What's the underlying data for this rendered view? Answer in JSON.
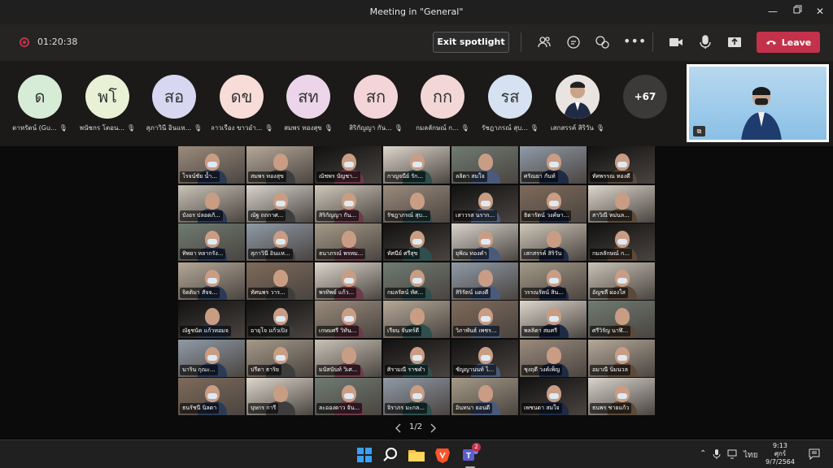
{
  "window": {
    "title": "Meeting in \"General\""
  },
  "toolbar": {
    "timer": "01:20:38",
    "exit_spotlight_label": "Exit spotlight",
    "leave_label": "Leave"
  },
  "participants_strip": {
    "items": [
      {
        "initials": "ด",
        "name": "ดาหรัตน์ (Gu...",
        "color": "#d6ecd6"
      },
      {
        "initials": "พโ",
        "name": "พนัชกร โตอน...",
        "color": "#e8f0d6"
      },
      {
        "initials": "สอ",
        "name": "สุภาวินี อินแห...",
        "color": "#d8d7f2"
      },
      {
        "initials": "ดข",
        "name": "ดาวเรือง ขาวอำ...",
        "color": "#f7dcd7"
      },
      {
        "initials": "สท",
        "name": "สมพร ทองสุข",
        "color": "#ecd5ea"
      },
      {
        "initials": "สก",
        "name": "สิริกัญญา กัน...",
        "color": "#f3d5d9"
      },
      {
        "initials": "กก",
        "name": "กมลลักษณ์ ก...",
        "color": "#f3d7d7"
      },
      {
        "initials": "รส",
        "name": "รัชฎาภรณ์ สุบ...",
        "color": "#d6e2f2"
      },
      {
        "initials": "",
        "name": "เสกสรรค์ สิริวัน",
        "color": "#c7b8a8"
      }
    ],
    "more_count": "+67"
  },
  "grid": {
    "tiles": [
      "โรจน์ชัย น้ำ...",
      "สมพร ทองสุข",
      "ณัชพร บัญชา...",
      "กาญจนีย์ รัก...",
      "ลลิตา สมใจ",
      "ศรัณยา กันท์",
      "ทัศพรรณ ทองดี",
      "บังอร ปลอดภั...",
      "ณัฐ ถถกาศ...",
      "สิริกัญญา กัน...",
      "รัชฎาภรณ์ สุบ...",
      "เสาวรส นราก...",
      "ธิดารัตน์ วงค์ษา...",
      "สาวิณี หม่นล...",
      "ทิพยา หลากรัง...",
      "สุภาวินี อินแห...",
      "ธนาภรณ์ พรหม...",
      "ทัศนีย์ ศรีสุข",
      "ยุพิณ ทองคำ",
      "เสกสรรค์ สิริวัน",
      "กมลลักษณ์ ก...",
      "จิตติมา สัจจ...",
      "ทัศนพร วาร...",
      "พรทิพย์ แก้ว...",
      "กมลรัตน์ ทัศ...",
      "สิริรัตน์ แดงดี",
      "วรรณรัตน์ สิน...",
      "อัญชลี ผ่องใส",
      "ณัฐชนัด แก้วหอมจ",
      "อายุโจ แก้วเปิง",
      "เกษมศรี วิทัน...",
      "เรียน จันทร์ดี",
      "วิภาพันธ์ เพชร...",
      "พลลิดา สมศรี",
      "ศรีวิรัญ นาฬิ...",
      "นาริน กุณะ...",
      "ปรีดา ธาริย",
      "มนัสนันท์ วิเศ...",
      "ศิรามณี ราชคำ",
      "ชัญญานนท์ ไ...",
      "ชุงฤดี วงค์เพ็ญ",
      "อมาณี นิ่มนวล",
      "ธนรัชนี นิลดา",
      "บุษกร การี",
      "ละอองดาว จัน...",
      "จิราภร มะกล...",
      "อินทนา ยอนดี",
      "เพชนดา สมใจ",
      "ธนพร ชายแก้ว"
    ]
  },
  "pager": {
    "label": "1/2"
  },
  "taskbar": {
    "language": "ไทย",
    "time": "9:13",
    "day": "ศุกร์",
    "date": "9/7/2564",
    "teams_badge": "2"
  }
}
